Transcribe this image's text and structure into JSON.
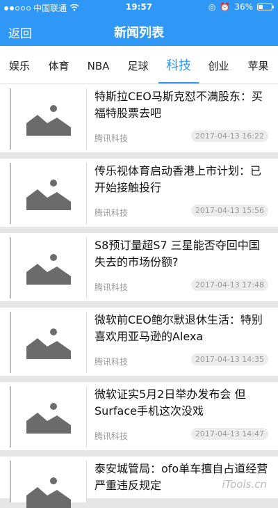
{
  "status": {
    "carrier": "中国联通",
    "time": "19:57",
    "battery": "36%",
    "battery_level": 0.36
  },
  "nav": {
    "back_label": "返回",
    "title": "新闻列表"
  },
  "tabs": [
    {
      "label": "娱乐",
      "active": false
    },
    {
      "label": "体育",
      "active": false
    },
    {
      "label": "NBA",
      "active": false
    },
    {
      "label": "足球",
      "active": false
    },
    {
      "label": "科技",
      "active": true
    },
    {
      "label": "创业",
      "active": false
    },
    {
      "label": "苹果",
      "active": false
    }
  ],
  "news": [
    {
      "title": "特斯拉CEO马斯克怼不满股东：买福特股票去吧",
      "source": "腾讯科技",
      "time": "2017-04-13 16:22"
    },
    {
      "title": "传乐视体育启动香港上市计划：已开始接触投行",
      "source": "腾讯科技",
      "time": "2017-04-13 15:56"
    },
    {
      "title": "S8预订量超S7 三星能否夺回中国失去的市场份额?",
      "source": "腾讯科技",
      "time": "2017-04-13 17:48"
    },
    {
      "title": "微软前CEO鲍尔默退休生活：特别喜欢用亚马逊的Alexa",
      "source": "腾讯科技",
      "time": "2017-04-13 14:35"
    },
    {
      "title": "微软证实5月2日举办发布会 但Surface手机这次没戏",
      "source": "腾讯科技",
      "time": "2017-04-13 14:47"
    },
    {
      "title": "泰安城管局：ofo单车擅自占道经营 严重违反规定",
      "source": "",
      "time": ""
    }
  ],
  "watermark": "iTools.cn"
}
